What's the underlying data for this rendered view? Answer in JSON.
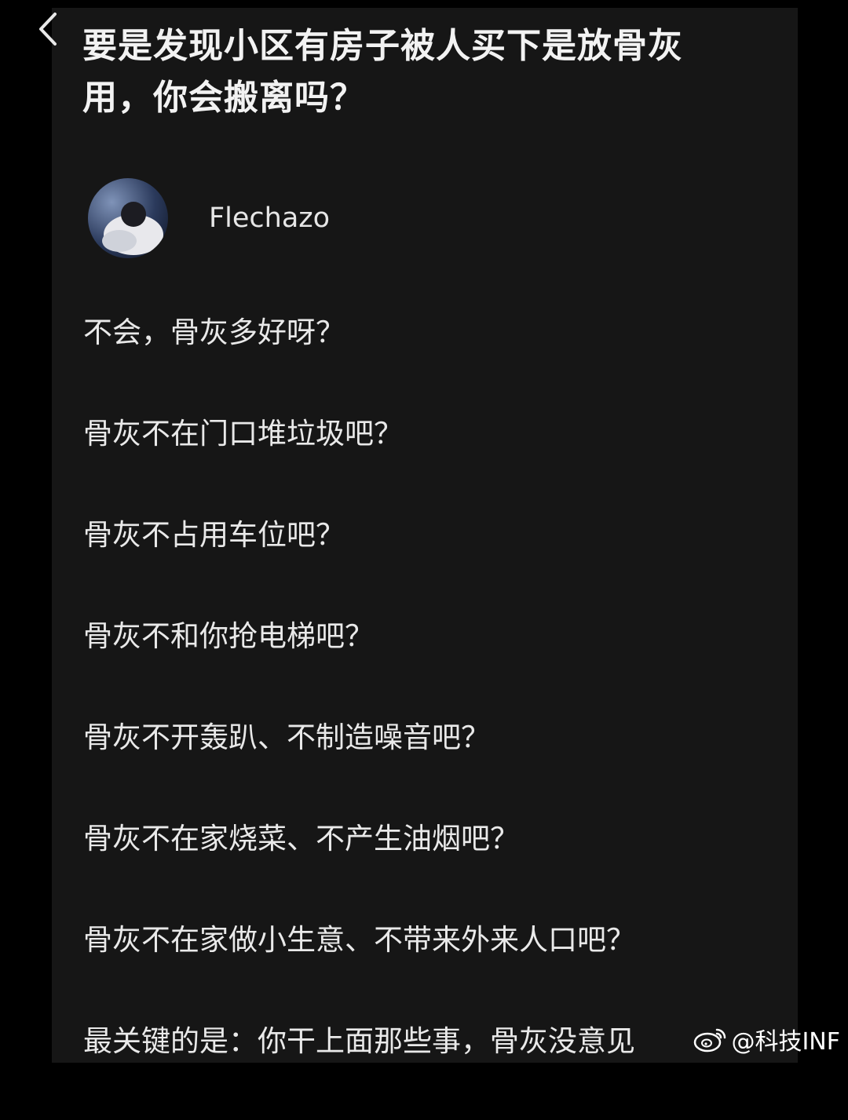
{
  "header": {
    "back_icon": "chevron-left-icon",
    "question": "要是发现小区有房子被人买下是放骨灰用，你会搬离吗？"
  },
  "answer": {
    "author": {
      "name": "Flechazo",
      "avatar_icon": "avatar"
    },
    "lines": [
      "不会，骨灰多好呀？",
      "骨灰不在门口堆垃圾吧？",
      "骨灰不占用车位吧？",
      "骨灰不和你抢电梯吧？",
      "骨灰不开轰趴、不制造噪音吧？",
      "骨灰不在家烧菜、不产生油烟吧？",
      "骨灰不在家做小生意、不带来外来人口吧？",
      "最关键的是：你干上面那些事，骨灰没意见"
    ]
  },
  "watermark": {
    "icon": "weibo-logo-icon",
    "text": "@科技INF"
  },
  "colors": {
    "background": "#000000",
    "panel": "#161616",
    "text": "#e9e9e9"
  }
}
